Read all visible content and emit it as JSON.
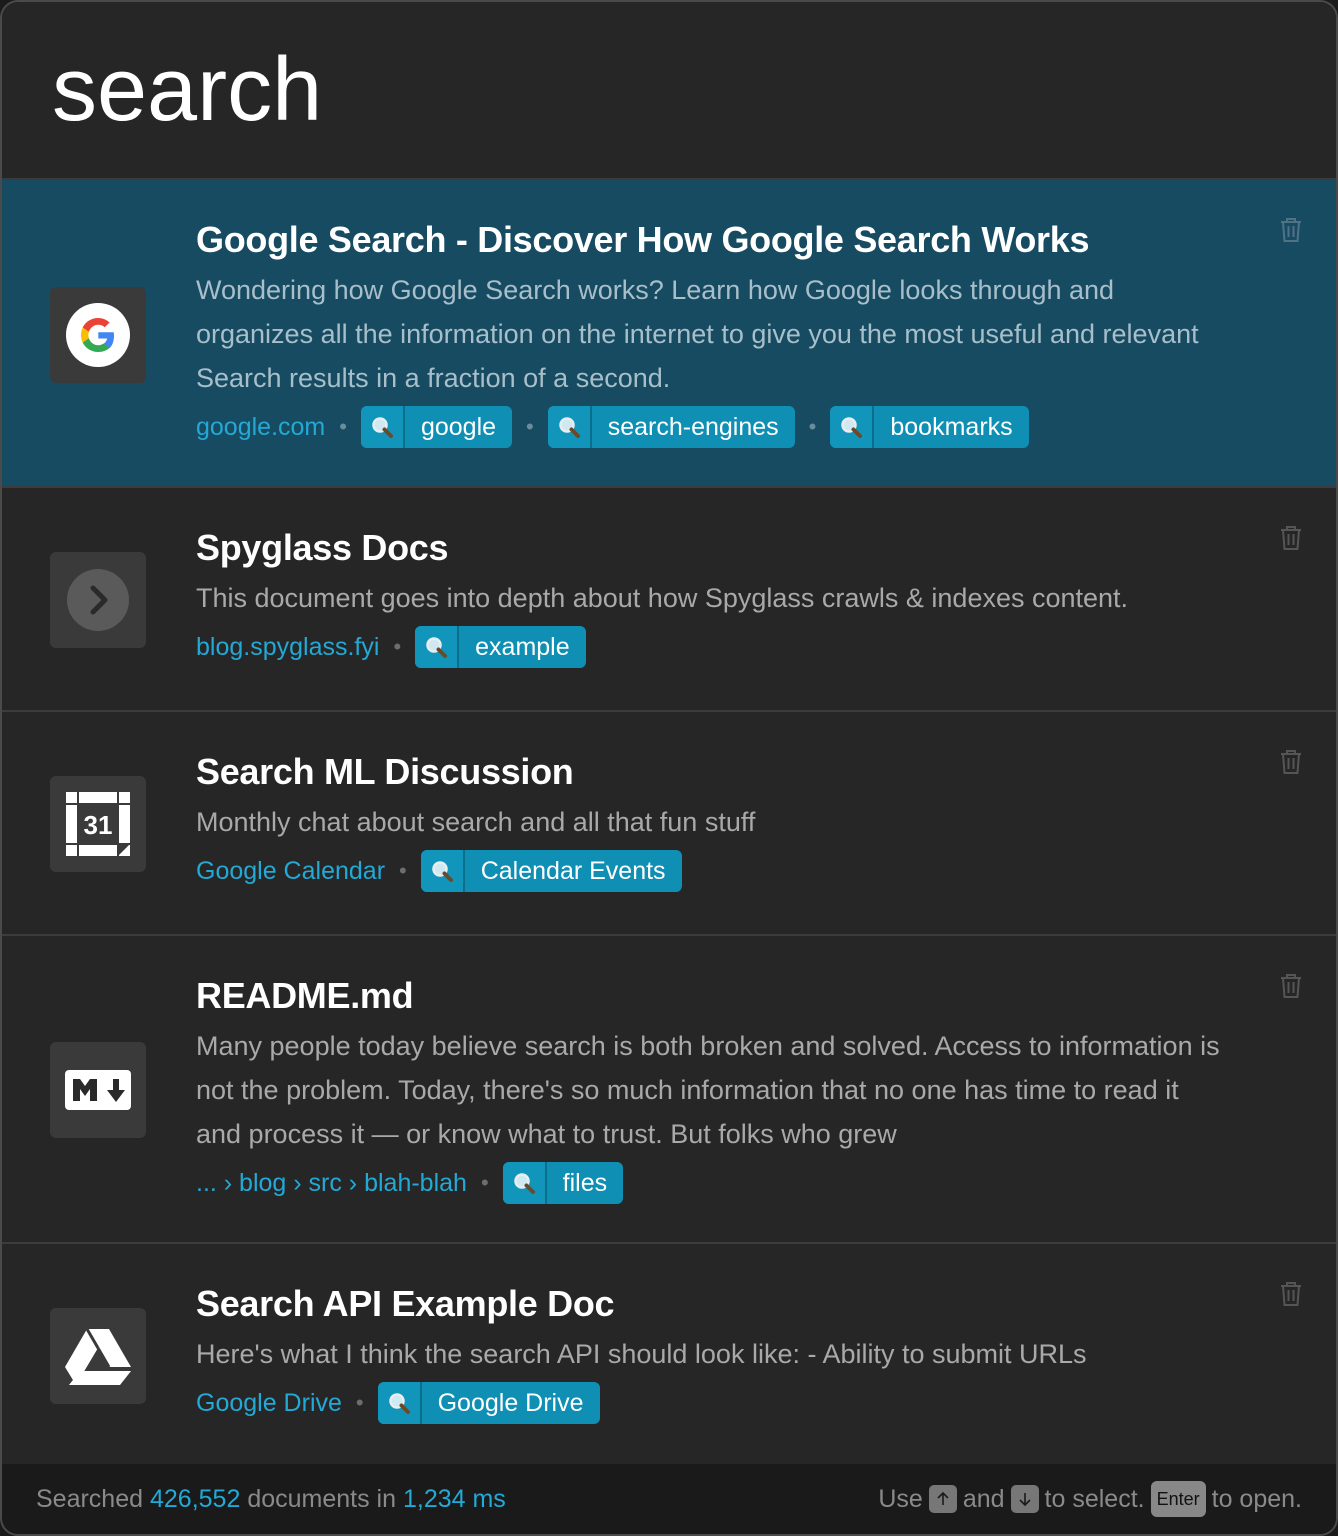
{
  "search": {
    "query": "search"
  },
  "results": [
    {
      "title": "Google Search - Discover How Google Search Works",
      "description": "Wondering how Google Search works? Learn how Google looks through and organizes all the information on the internet to give you the most useful and relevant Search results in a fraction of a second.",
      "domain": "google.com",
      "tags": [
        "google",
        "search-engines",
        "bookmarks"
      ],
      "icon": "google-logo-icon"
    },
    {
      "title": "Spyglass Docs",
      "description": "This document goes into depth about how Spyglass crawls & indexes content.",
      "domain": "blog.spyglass.fyi",
      "tags": [
        "example"
      ],
      "icon": "chevron-right-icon"
    },
    {
      "title": "Search ML Discussion",
      "description": "Monthly chat about search and all that fun stuff",
      "domain": "Google Calendar",
      "tags": [
        "Calendar Events"
      ],
      "icon": "calendar-icon",
      "calendar_day": "31"
    },
    {
      "title": "README.md",
      "description": "Many people today believe search is both broken and solved. Access to information is not the problem. Today, there's so much information that no one has time to read it and process it — or know what to trust. But folks who grew",
      "domain": "... › blog › src › blah-blah",
      "tags": [
        "files"
      ],
      "icon": "markdown-icon"
    },
    {
      "title": "Search API Example Doc",
      "description": "Here's what I think the search API should look like: - Ability to submit URLs",
      "domain": "Google Drive",
      "tags": [
        "Google Drive"
      ],
      "icon": "google-drive-icon"
    }
  ],
  "separator": "•",
  "footer": {
    "prefix": "Searched",
    "doc_count": "426,552",
    "middle": "documents in",
    "duration": "1,234 ms",
    "use": "Use",
    "and": "and",
    "to_select": "to select.",
    "enter_key": "Enter",
    "to_open": "to open."
  },
  "colors": {
    "accent": "#22a9d6",
    "selected_row": "#174b62",
    "tag_bg": "#0f8fb4"
  }
}
